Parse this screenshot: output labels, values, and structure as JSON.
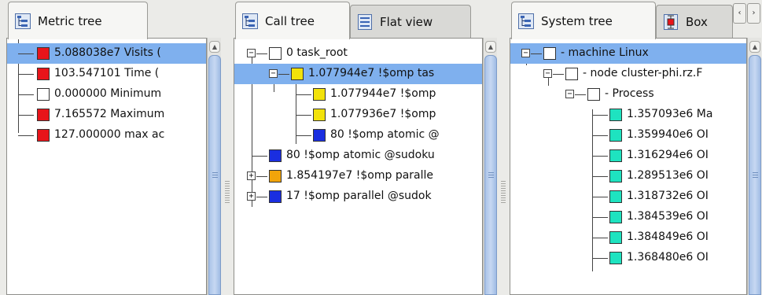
{
  "metric_panel": {
    "tabs": [
      {
        "label": "Metric tree",
        "icon": "tree-icon"
      }
    ],
    "rows": [
      {
        "text": "5.088038e7 Visits (",
        "color": "#e8141a",
        "selected": true
      },
      {
        "text": "103.547101 Time (",
        "color": "#e8141a",
        "selected": false
      },
      {
        "text": "0.000000 Minimum",
        "color": "#ffffff",
        "selected": false
      },
      {
        "text": "7.165572 Maximum",
        "color": "#e8141a",
        "selected": false
      },
      {
        "text": "127.000000 max ac",
        "color": "#e8141a",
        "selected": false
      }
    ]
  },
  "call_panel": {
    "tabs": [
      {
        "label": "Call tree",
        "icon": "tree-icon"
      },
      {
        "label": "Flat view",
        "icon": "list-icon"
      }
    ],
    "rows": [
      {
        "text": "0 task_root",
        "color": "#ffffff",
        "expander": "−"
      },
      {
        "text": "1.077944e7 !$omp tas",
        "color": "#f2e20a",
        "expander": "−",
        "selected": true
      },
      {
        "text": "1.077944e7 !$omp",
        "color": "#f2e20a"
      },
      {
        "text": "1.077936e7 !$omp",
        "color": "#f2e20a"
      },
      {
        "text": "80 !$omp atomic @",
        "color": "#1a2ee0"
      },
      {
        "text": "80 !$omp atomic @sudoku",
        "color": "#1a2ee0"
      },
      {
        "text": "1.854197e7 !$omp paralle",
        "color": "#f2a40a",
        "expander": "+"
      },
      {
        "text": "17 !$omp parallel @sudok",
        "color": "#1a2ee0",
        "expander": "+"
      }
    ]
  },
  "system_panel": {
    "tabs": [
      {
        "label": "System tree",
        "icon": "tree-icon"
      },
      {
        "label": "Box",
        "icon": "boxplot-icon"
      }
    ],
    "nav": {
      "prev": "‹",
      "next": "›"
    },
    "rows": [
      {
        "text": "- machine Linux",
        "color": "#ffffff",
        "expander": "−",
        "selected": true
      },
      {
        "text": "- node cluster-phi.rz.F",
        "color": "#ffffff",
        "expander": "−"
      },
      {
        "text": "- Process",
        "color": "#ffffff",
        "expander": "−"
      },
      {
        "text": "1.357093e6 Ma",
        "color": "#1ee3c0"
      },
      {
        "text": "1.359940e6 OI",
        "color": "#1ee3c0"
      },
      {
        "text": "1.316294e6 OI",
        "color": "#1ee3c0"
      },
      {
        "text": "1.289513e6 OI",
        "color": "#1ee3c0"
      },
      {
        "text": "1.318732e6 OI",
        "color": "#1ee3c0"
      },
      {
        "text": "1.384539e6 OI",
        "color": "#1ee3c0"
      },
      {
        "text": "1.384849e6 OI",
        "color": "#1ee3c0"
      },
      {
        "text": "1.368480e6 OI",
        "color": "#1ee3c0"
      }
    ]
  }
}
